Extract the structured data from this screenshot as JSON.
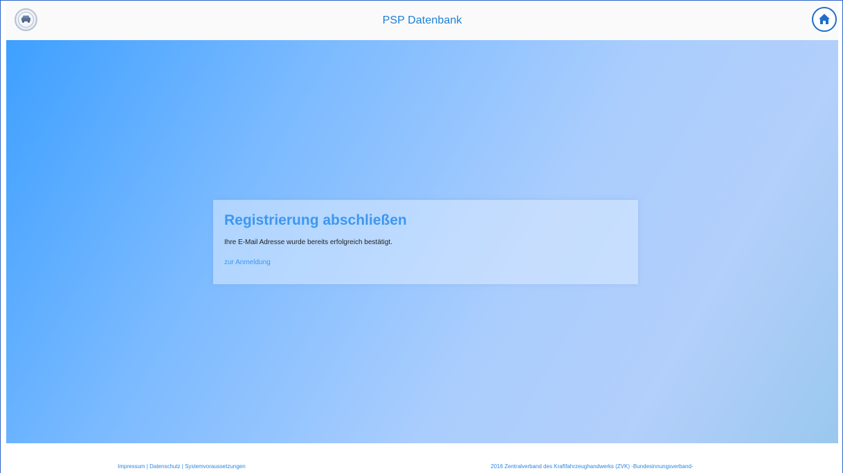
{
  "header": {
    "title": "PSP Datenbank",
    "logo_icon": "emblem-logo-icon",
    "home_icon": "home-icon"
  },
  "card": {
    "title": "Registrierung abschließen",
    "message": "Ihre E-Mail Adresse wurde bereits erfolgreich bestätigt.",
    "link_label": "zur Anmeldung"
  },
  "footer": {
    "links": [
      "Impressum",
      "Datenschutz",
      "Systemvoraussetzungen"
    ],
    "separator": " | ",
    "copyright": "2016 Zentralverband des Kraftfahrzeughandwerks (ZVK) -Bundesinnungsverband-"
  },
  "colors": {
    "accent": "#3d97ef",
    "header_title": "#1d7fd6",
    "home_border": "#1f6ec9"
  }
}
